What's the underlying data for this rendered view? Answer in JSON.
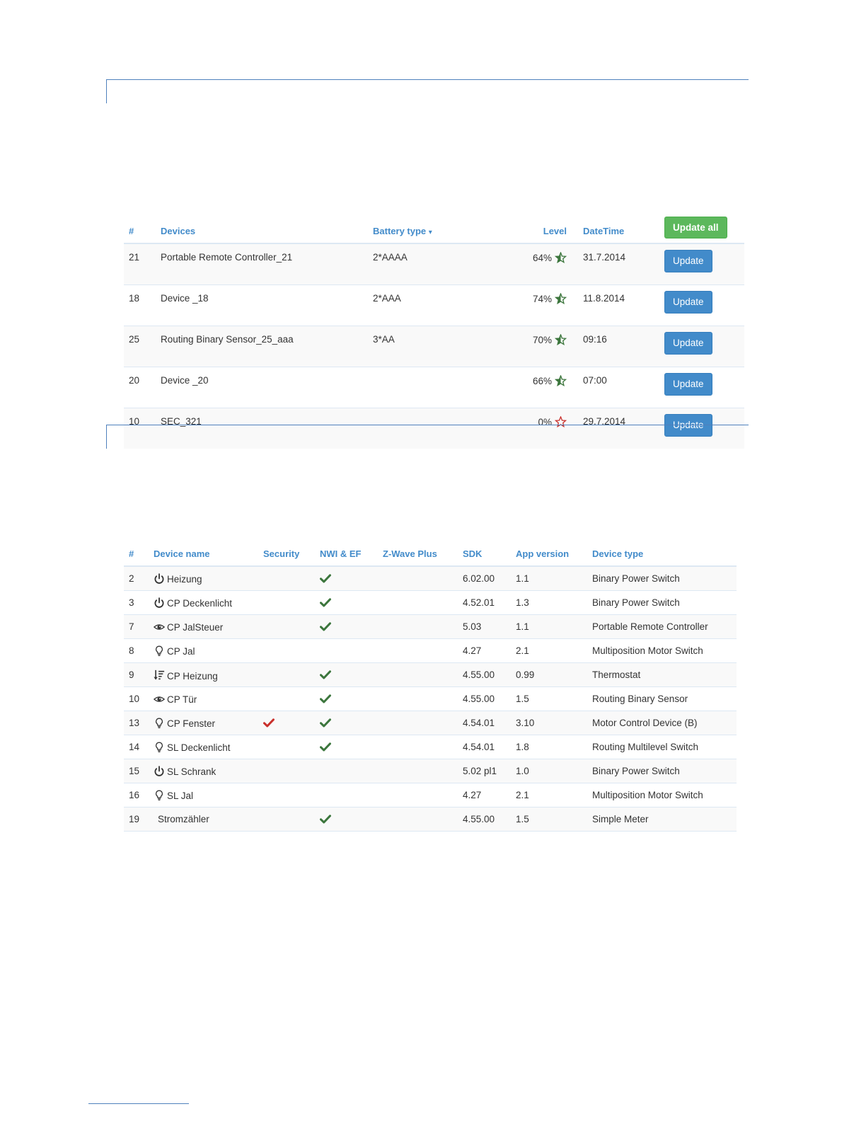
{
  "colors": {
    "accent": "#428bca",
    "green": "#5cb85c",
    "check_green": "#3c763d",
    "check_red": "#c9302c",
    "star_green": "#3c763d",
    "star_red": "#c9302c"
  },
  "battery": {
    "headers": {
      "num": "#",
      "devices": "Devices",
      "battery_type": "Battery type",
      "level": "Level",
      "datetime": "DateTime"
    },
    "sort_indicator": "▾",
    "update_all_label": "Update all",
    "update_label": "Update",
    "rows": [
      {
        "num": "21",
        "device": "Portable Remote Controller_21",
        "battery_type": "2*AAAA",
        "level": "64%",
        "level_value": 64,
        "star": "star-half",
        "datetime": "31.7.2014"
      },
      {
        "num": "18",
        "device": "Device _18",
        "battery_type": "2*AAA",
        "level": "74%",
        "level_value": 74,
        "star": "star-half",
        "datetime": "11.8.2014"
      },
      {
        "num": "25",
        "device": "Routing Binary Sensor_25_aaa",
        "battery_type": "3*AA",
        "level": "70%",
        "level_value": 70,
        "star": "star-half",
        "datetime": "09:16"
      },
      {
        "num": "20",
        "device": "Device _20",
        "battery_type": "",
        "level": "66%",
        "level_value": 66,
        "star": "star-half",
        "datetime": "07:00"
      },
      {
        "num": "10",
        "device": "SEC_321",
        "battery_type": "",
        "level": "0%",
        "level_value": 0,
        "star": "star-empty",
        "datetime": "29.7.2014"
      }
    ]
  },
  "devices": {
    "headers": {
      "num": "#",
      "name": "Device name",
      "security": "Security",
      "nwi": "NWI & EF",
      "zwave": "Z-Wave Plus",
      "sdk": "SDK",
      "app": "App version",
      "type": "Device type"
    },
    "rows": [
      {
        "num": "2",
        "icon": "power-icon",
        "name": "Heizung",
        "security": false,
        "nwi": true,
        "zwave": false,
        "sdk": "6.02.00",
        "app": "1.1",
        "type": "Binary Power Switch"
      },
      {
        "num": "3",
        "icon": "power-icon",
        "name": "CP Deckenlicht",
        "security": false,
        "nwi": true,
        "zwave": false,
        "sdk": "4.52.01",
        "app": "1.3",
        "type": "Binary Power Switch"
      },
      {
        "num": "7",
        "icon": "eye-icon",
        "name": "CP JalSteuer",
        "security": false,
        "nwi": true,
        "zwave": false,
        "sdk": "5.03",
        "app": "1.1",
        "type": "Portable Remote Controller"
      },
      {
        "num": "8",
        "icon": "lightbulb-icon",
        "name": "CP Jal",
        "security": false,
        "nwi": false,
        "zwave": false,
        "sdk": "4.27",
        "app": "2.1",
        "type": "Multiposition Motor Switch"
      },
      {
        "num": "9",
        "icon": "sort-icon",
        "name": "CP Heizung",
        "security": false,
        "nwi": true,
        "zwave": false,
        "sdk": "4.55.00",
        "app": "0.99",
        "type": "Thermostat"
      },
      {
        "num": "10",
        "icon": "eye-icon",
        "name": "CP Tür",
        "security": false,
        "nwi": true,
        "zwave": false,
        "sdk": "4.55.00",
        "app": "1.5",
        "type": "Routing Binary Sensor"
      },
      {
        "num": "13",
        "icon": "lightbulb-icon",
        "name": "CP Fenster",
        "security": true,
        "nwi": true,
        "zwave": false,
        "sdk": "4.54.01",
        "app": "3.10",
        "type": "Motor Control Device (B)"
      },
      {
        "num": "14",
        "icon": "lightbulb-icon",
        "name": "SL Deckenlicht",
        "security": false,
        "nwi": true,
        "zwave": false,
        "sdk": "4.54.01",
        "app": "1.8",
        "type": "Routing Multilevel Switch"
      },
      {
        "num": "15",
        "icon": "power-icon",
        "name": "SL Schrank",
        "security": false,
        "nwi": false,
        "zwave": false,
        "sdk": "5.02 pl1",
        "app": "1.0",
        "type": "Binary Power Switch"
      },
      {
        "num": "16",
        "icon": "lightbulb-icon",
        "name": "SL Jal",
        "security": false,
        "nwi": false,
        "zwave": false,
        "sdk": "4.27",
        "app": "2.1",
        "type": "Multiposition Motor Switch"
      },
      {
        "num": "19",
        "icon": "",
        "name": "Stromzähler",
        "security": false,
        "nwi": true,
        "zwave": false,
        "sdk": "4.55.00",
        "app": "1.5",
        "type": "Simple Meter"
      }
    ]
  }
}
